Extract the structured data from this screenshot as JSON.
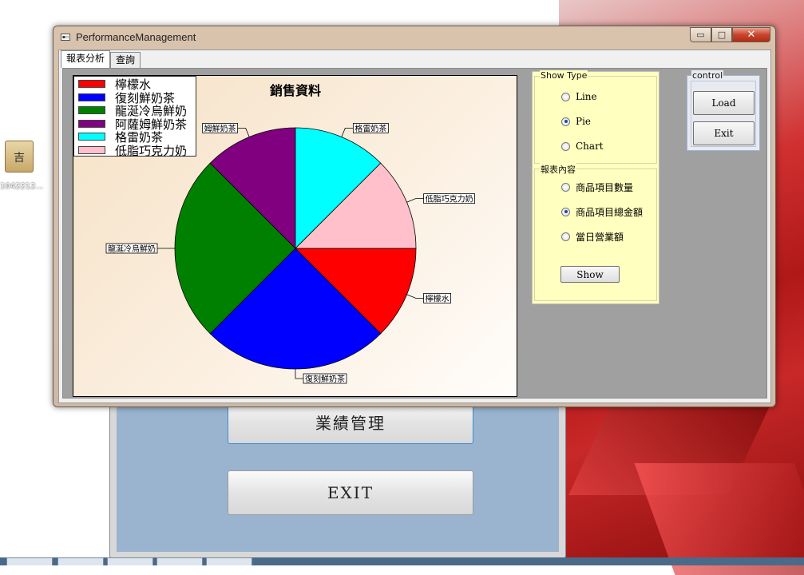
{
  "desktop": {
    "icon_label": "1042212..."
  },
  "background_window": {
    "button1_label": "業績管理",
    "button2_label": "EXIT"
  },
  "window": {
    "title": "PerformanceManagement",
    "controls": {
      "minimize": "▭",
      "maximize": "□",
      "close": "✕"
    }
  },
  "tabs": [
    {
      "label": "報表分析",
      "active": true
    },
    {
      "label": "查詢",
      "active": false
    }
  ],
  "chart_data": {
    "type": "pie",
    "title": "銷售資料",
    "categories": [
      "檸檬水",
      "復刻鮮奶茶",
      "龍涎冷烏鮮奶",
      "阿薩姆鮮奶茶",
      "格雷奶茶",
      "低脂巧克力奶"
    ],
    "values": [
      12.5,
      25,
      25,
      12.5,
      12.5,
      12.5
    ],
    "colors": [
      "#ff0000",
      "#0000ff",
      "#008000",
      "#800080",
      "#00ffff",
      "#ffc0cb"
    ],
    "slice_labels": [
      "檸檬水",
      "復刻鮮奶茶",
      "龍涎冷烏鮮奶",
      "姆鮮奶茶",
      "格雷奶茶",
      "低脂巧克力奶"
    ],
    "legend_position": "top-left"
  },
  "show_type": {
    "title": "Show Type",
    "options": [
      {
        "label": "Line",
        "checked": false
      },
      {
        "label": "Pie",
        "checked": true
      },
      {
        "label": "Chart",
        "checked": false
      }
    ]
  },
  "report_content": {
    "title": "報表內容",
    "options": [
      {
        "label": "商品項目數量",
        "checked": false
      },
      {
        "label": "商品項目總金額",
        "checked": true
      },
      {
        "label": "當日營業額",
        "checked": false
      }
    ],
    "show_button": "Show"
  },
  "control": {
    "title": "control",
    "load_button": "Load",
    "exit_button": "Exit"
  }
}
